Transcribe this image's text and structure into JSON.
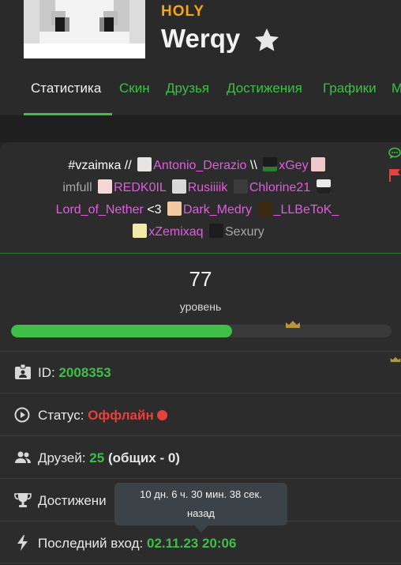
{
  "profile": {
    "rank": "HOLY",
    "nickname": "Werqy"
  },
  "tabs": [
    {
      "label": "Статистика",
      "active": true
    },
    {
      "label": "Скин"
    },
    {
      "label": "Друзья"
    },
    {
      "label": "Достижения"
    },
    {
      "label": "Графики"
    },
    {
      "label": "М"
    }
  ],
  "bio": {
    "prefix": "#vzaimка  //",
    "user1": "Antonio_Derazio",
    "mid": "\\\\",
    "user2": "xGey",
    "user3": "imfull",
    "user4": "REDK0IL",
    "user5": "Rusiiiik",
    "user6": "Chlorine21",
    "user7": "Lord_of_Nether",
    "heart": "<3",
    "user8": "Dark_Medry",
    "user9": "_LLBeToK_",
    "user10": "xZemixaq",
    "user11": "Sexury"
  },
  "level": {
    "value": "77",
    "label": "уровень",
    "progress_percent": 58
  },
  "stats": {
    "id_label": "ID:",
    "id_value": "2008353",
    "status_label": "Статус:",
    "status_value": "Оффлайн",
    "friends_label": "Друзей:",
    "friends_value": "25",
    "friends_common": "(общих - 0)",
    "achievements_label": "Достижени",
    "last_login_label": "Последний вход:",
    "last_login_value": "02.11.23 20:06"
  },
  "tooltip": {
    "line1": "10 дн. 6 ч. 30 мин. 38 сек.",
    "line2": "назад"
  },
  "colors": {
    "accent": "#3fbf48",
    "rank": "#f0a51e",
    "nickname_link": "#e25ce0",
    "offline": "#e8403a"
  }
}
